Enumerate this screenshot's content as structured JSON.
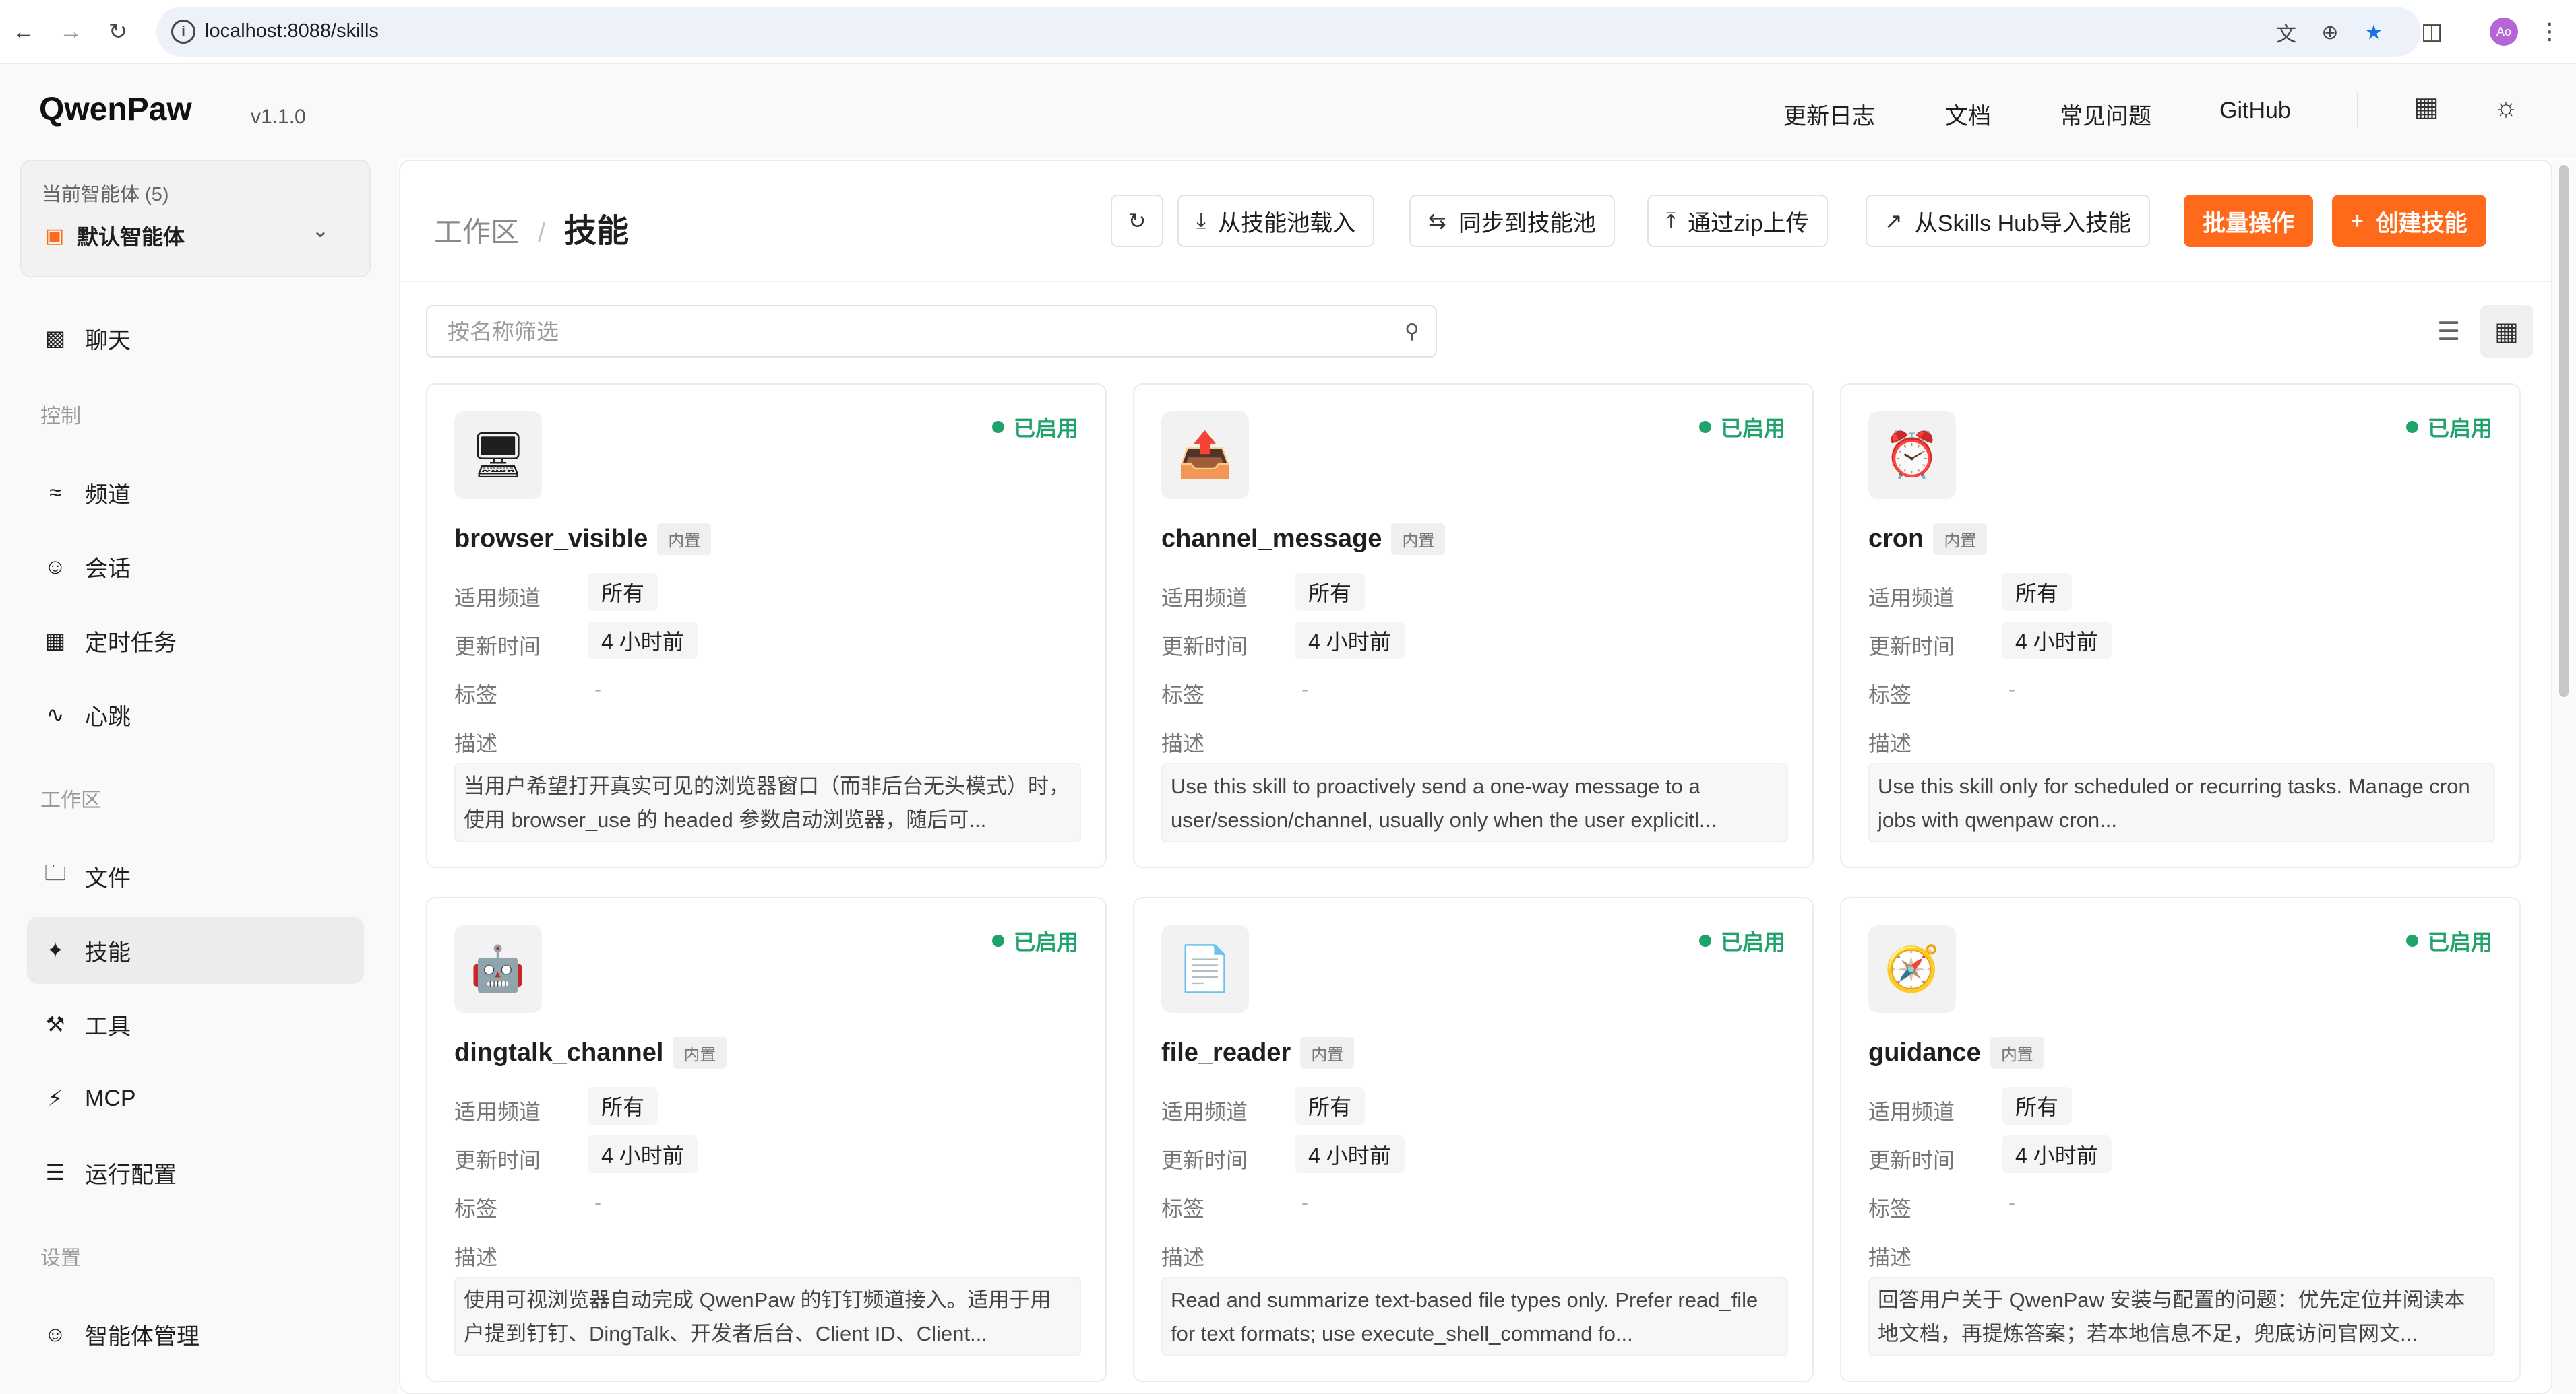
{
  "browser": {
    "url": "localhost:8088/skills",
    "avatar_initials": "Ao"
  },
  "header": {
    "logo": "QwenPaw",
    "version": "v1.1.0",
    "links": [
      "更新日志",
      "文档",
      "常见问题",
      "GitHub"
    ]
  },
  "sidebar": {
    "agent_label": "当前智能体 (5)",
    "agent_name": "默认智能体",
    "chat": "聊天",
    "section_control": "控制",
    "channels": "频道",
    "sessions": "会话",
    "cron": "定时任务",
    "heartbeat": "心跳",
    "section_workspace": "工作区",
    "files": "文件",
    "skills": "技能",
    "tools": "工具",
    "mcp": "MCP",
    "runtime": "运行配置",
    "section_settings": "设置",
    "agent_mgmt": "智能体管理"
  },
  "page": {
    "crumb_parent": "工作区",
    "crumb_sep": "/",
    "title": "技能",
    "btn_load_pool": "从技能池载入",
    "btn_sync_pool": "同步到技能池",
    "btn_upload_zip": "通过zip上传",
    "btn_import_hub": "从Skills Hub导入技能",
    "btn_batch": "批量操作",
    "btn_create": "创建技能",
    "filter_placeholder": "按名称筛选"
  },
  "labels": {
    "channel": "适用频道",
    "updated": "更新时间",
    "tags": "标签",
    "desc": "描述",
    "status_enabled": "已启用",
    "builtin": "内置"
  },
  "skills": [
    {
      "name": "browser_visible",
      "icon": "monitor-icon",
      "channel": "所有",
      "updated": "4 小时前",
      "tags": "-",
      "description": "当用户希望打开真实可见的浏览器窗口（而非后台无头模式）时，使用 browser_use 的 headed 参数启动浏览器，随后可..."
    },
    {
      "name": "channel_message",
      "icon": "outbox-tray-icon",
      "channel": "所有",
      "updated": "4 小时前",
      "tags": "-",
      "description": "Use this skill to proactively send a one-way message to a user/session/channel, usually only when the user explicitl..."
    },
    {
      "name": "cron",
      "icon": "alarm-clock-icon",
      "channel": "所有",
      "updated": "4 小时前",
      "tags": "-",
      "description": "Use this skill only for scheduled or recurring tasks. Manage cron jobs with qwenpaw cron..."
    },
    {
      "name": "dingtalk_channel",
      "icon": "robot-icon",
      "channel": "所有",
      "updated": "4 小时前",
      "tags": "-",
      "description": "使用可视浏览器自动完成 QwenPaw 的钉钉频道接入。适用于用户提到钉钉、DingTalk、开发者后台、Client ID、Client..."
    },
    {
      "name": "file_reader",
      "icon": "document-icon",
      "channel": "所有",
      "updated": "4 小时前",
      "tags": "-",
      "description": "Read and summarize text-based file types only. Prefer read_file for text formats; use execute_shell_command fo..."
    },
    {
      "name": "guidance",
      "icon": "compass-icon",
      "channel": "所有",
      "updated": "4 小时前",
      "tags": "-",
      "description": "回答用户关于 QwenPaw 安装与配置的问题：优先定位并阅读本地文档，再提炼答案；若本地信息不足，兜底访问官网文..."
    }
  ],
  "colors": {
    "accent": "#ff6a1a",
    "enabled": "#1fa36b"
  }
}
